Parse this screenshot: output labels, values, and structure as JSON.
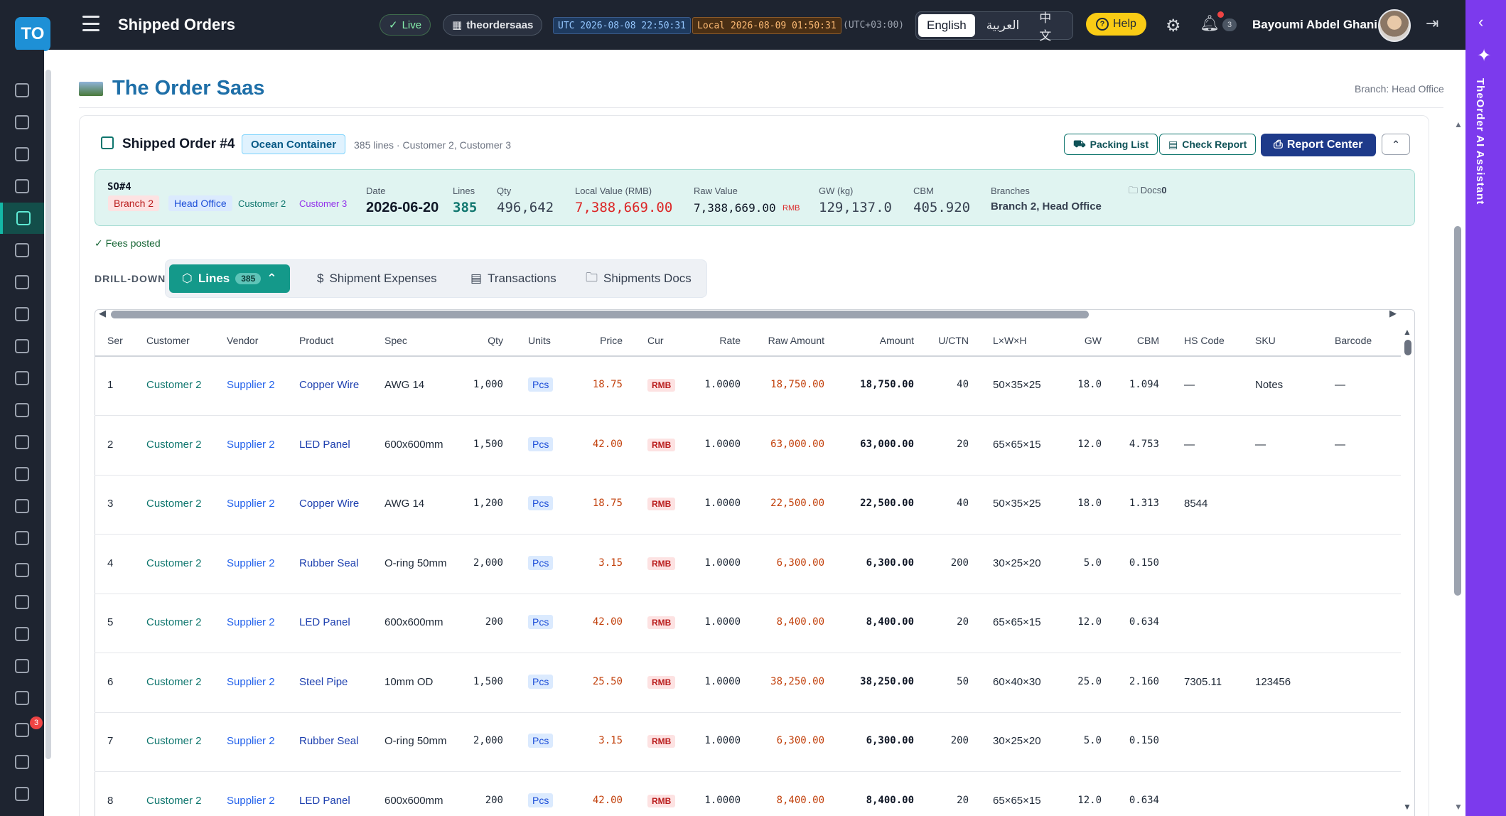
{
  "header": {
    "logo": "TO",
    "app_title": "Shipped Orders",
    "live_label": "Live",
    "tenant": "theordersaas",
    "utc_clock": "UTC 2026-08-08 22:50:31",
    "local_clock": "Local 2026-08-09 01:50:31",
    "timezone": "(UTC+03:00)",
    "languages": [
      "English",
      "العربية",
      "中文"
    ],
    "help_label": "Help",
    "notification_count": "3",
    "user_name": "Bayoumi Abdel Ghani"
  },
  "sidebar": {
    "badge": "3"
  },
  "ai_assistant": {
    "label": "TheOrder AI Assistant"
  },
  "page": {
    "brand_title": "The Order Saas",
    "branch_label": "Branch: Head Office"
  },
  "order": {
    "title": "Shipped Order #4",
    "mode": "Ocean Container",
    "subtitle": "385 lines · Customer 2, Customer 3",
    "buttons": {
      "packing": "Packing List",
      "check": "Check Report",
      "report": "Report Center"
    },
    "so_number": "SO#4",
    "tags": {
      "branch2": "Branch 2",
      "head_office": "Head Office",
      "customer2": "Customer 2",
      "customer3": "Customer 3"
    },
    "stats": {
      "date_label": "Date",
      "date": "2026-06-20",
      "lines_label": "Lines",
      "lines": "385",
      "qty_label": "Qty",
      "qty": "496,642",
      "local_label": "Local Value (RMB)",
      "local": "7,388,669.00",
      "raw_label": "Raw Value",
      "raw": "7,388,669.00",
      "raw_cur": "RMB",
      "gw_label": "GW (kg)",
      "gw": "129,137.0",
      "cbm_label": "CBM",
      "cbm": "405.920",
      "branches_label": "Branches",
      "branches": "Branch 2, Head Office",
      "docs_label": "Docs",
      "docs_count": "0"
    },
    "fees_posted": "✓ Fees posted"
  },
  "drilldown": {
    "label": "DRILL-DOWN",
    "tabs": {
      "lines": "Lines",
      "lines_count": "385",
      "expenses": "Shipment Expenses",
      "transactions": "Transactions",
      "docs": "Shipments Docs"
    }
  },
  "table": {
    "columns": [
      "Ser",
      "Customer",
      "Vendor",
      "Product",
      "Spec",
      "Qty",
      "Units",
      "Price",
      "Cur",
      "Rate",
      "Raw Amount",
      "Amount",
      "U/CTN",
      "L×W×H",
      "GW",
      "CBM",
      "HS Code",
      "SKU",
      "Barcode"
    ],
    "rows": [
      {
        "ser": "1",
        "customer": "Customer 2",
        "vendor": "Supplier 2",
        "product": "Copper Wire",
        "spec": "AWG 14",
        "qty": "1,000",
        "units": "Pcs",
        "price": "18.75",
        "cur": "RMB",
        "rate": "1.0000",
        "raw": "18,750.00",
        "amount": "18,750.00",
        "uctn": "40",
        "dims": "50×35×25",
        "gw": "18.0",
        "cbm": "1.094",
        "hs": "—",
        "sku": "Notes",
        "barcode": "—"
      },
      {
        "ser": "2",
        "customer": "Customer 2",
        "vendor": "Supplier 2",
        "product": "LED Panel",
        "spec": "600x600mm",
        "qty": "1,500",
        "units": "Pcs",
        "price": "42.00",
        "cur": "RMB",
        "rate": "1.0000",
        "raw": "63,000.00",
        "amount": "63,000.00",
        "uctn": "20",
        "dims": "65×65×15",
        "gw": "12.0",
        "cbm": "4.753",
        "hs": "—",
        "sku": "—",
        "barcode": "—"
      },
      {
        "ser": "3",
        "customer": "Customer 2",
        "vendor": "Supplier 2",
        "product": "Copper Wire",
        "spec": "AWG 14",
        "qty": "1,200",
        "units": "Pcs",
        "price": "18.75",
        "cur": "RMB",
        "rate": "1.0000",
        "raw": "22,500.00",
        "amount": "22,500.00",
        "uctn": "40",
        "dims": "50×35×25",
        "gw": "18.0",
        "cbm": "1.313",
        "hs": "8544",
        "sku": "",
        "barcode": ""
      },
      {
        "ser": "4",
        "customer": "Customer 2",
        "vendor": "Supplier 2",
        "product": "Rubber Seal",
        "spec": "O-ring 50mm",
        "qty": "2,000",
        "units": "Pcs",
        "price": "3.15",
        "cur": "RMB",
        "rate": "1.0000",
        "raw": "6,300.00",
        "amount": "6,300.00",
        "uctn": "200",
        "dims": "30×25×20",
        "gw": "5.0",
        "cbm": "0.150",
        "hs": "",
        "sku": "",
        "barcode": ""
      },
      {
        "ser": "5",
        "customer": "Customer 2",
        "vendor": "Supplier 2",
        "product": "LED Panel",
        "spec": "600x600mm",
        "qty": "200",
        "units": "Pcs",
        "price": "42.00",
        "cur": "RMB",
        "rate": "1.0000",
        "raw": "8,400.00",
        "amount": "8,400.00",
        "uctn": "20",
        "dims": "65×65×15",
        "gw": "12.0",
        "cbm": "0.634",
        "hs": "",
        "sku": "",
        "barcode": ""
      },
      {
        "ser": "6",
        "customer": "Customer 2",
        "vendor": "Supplier 2",
        "product": "Steel Pipe",
        "spec": "10mm OD",
        "qty": "1,500",
        "units": "Pcs",
        "price": "25.50",
        "cur": "RMB",
        "rate": "1.0000",
        "raw": "38,250.00",
        "amount": "38,250.00",
        "uctn": "50",
        "dims": "60×40×30",
        "gw": "25.0",
        "cbm": "2.160",
        "hs": "7305.11",
        "sku": "123456",
        "barcode": ""
      },
      {
        "ser": "7",
        "customer": "Customer 2",
        "vendor": "Supplier 2",
        "product": "Rubber Seal",
        "spec": "O-ring 50mm",
        "qty": "2,000",
        "units": "Pcs",
        "price": "3.15",
        "cur": "RMB",
        "rate": "1.0000",
        "raw": "6,300.00",
        "amount": "6,300.00",
        "uctn": "200",
        "dims": "30×25×20",
        "gw": "5.0",
        "cbm": "0.150",
        "hs": "",
        "sku": "",
        "barcode": ""
      },
      {
        "ser": "8",
        "customer": "Customer 2",
        "vendor": "Supplier 2",
        "product": "LED Panel",
        "spec": "600x600mm",
        "qty": "200",
        "units": "Pcs",
        "price": "42.00",
        "cur": "RMB",
        "rate": "1.0000",
        "raw": "8,400.00",
        "amount": "8,400.00",
        "uctn": "20",
        "dims": "65×65×15",
        "gw": "12.0",
        "cbm": "0.634",
        "hs": "",
        "sku": "",
        "barcode": ""
      }
    ]
  },
  "colors": {
    "accent": "#14998a",
    "brand": "#1e6fa8",
    "ai": "#7c3aed",
    "topbar": "#1e2430"
  }
}
